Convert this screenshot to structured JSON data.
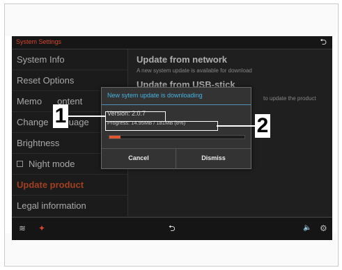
{
  "title_bar": {
    "title": "System Settings",
    "back_glyph": "⮌",
    "back_icon": "back-arrow-icon"
  },
  "sidebar": {
    "items": [
      {
        "label": "System Info",
        "active": false
      },
      {
        "label": "Reset Options",
        "active": false
      },
      {
        "label": "Memo",
        "active": false
      },
      {
        "label": "Change",
        "active": false
      },
      {
        "label": "Brightness",
        "active": false
      },
      {
        "label": "Night mode",
        "active": false,
        "checkbox": true
      },
      {
        "label": "Update product",
        "active": true
      },
      {
        "label": "Legal information",
        "active": false
      }
    ],
    "memo_tail": "ontent",
    "change_tail": "guage"
  },
  "main": {
    "network_title": "Update from network",
    "network_subtitle": "A new system update is available for download",
    "usb_title": "Update from USB-stick",
    "usb_subtitle": "to update the product"
  },
  "dialog": {
    "title": "New sytem update is downloading",
    "version": "Version: 2.0.7",
    "progress_text": "Progress: 14.95MB / 181MB (8%)",
    "progress_fraction": 0.08,
    "cancel_label": "Cancel",
    "dismiss_label": "Dismiss"
  },
  "status_bar": {
    "wifi_icon": "wifi-icon",
    "wifi_glyph": "≋",
    "app_icon": "app-icon",
    "app_glyph": "✦",
    "back_icon": "back-arrow-icon",
    "back_glyph": "⮌",
    "volume_icon": "volume-icon",
    "volume_glyph": "🔈",
    "settings_icon": "gear-icon",
    "settings_glyph": "⚙"
  },
  "callouts": {
    "one": "1",
    "two": "2"
  },
  "colors": {
    "accent": "#e0582e",
    "dialog_title": "#46b3e0"
  }
}
